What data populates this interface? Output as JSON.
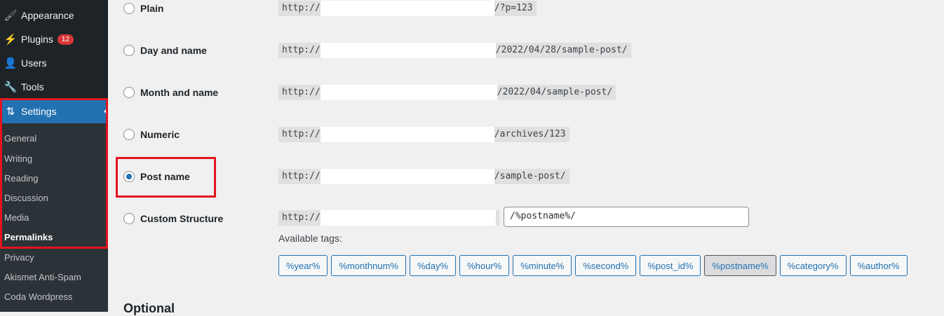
{
  "sidebar": {
    "menu": [
      {
        "label": "Appearance",
        "icon": "paintbrush-icon"
      },
      {
        "label": "Plugins",
        "icon": "plugin-icon",
        "badge": "12"
      },
      {
        "label": "Users",
        "icon": "user-icon"
      },
      {
        "label": "Tools",
        "icon": "wrench-icon"
      },
      {
        "label": "Settings",
        "icon": "settings-icon"
      }
    ],
    "submenu": [
      "General",
      "Writing",
      "Reading",
      "Discussion",
      "Media",
      "Permalinks",
      "Privacy",
      "Akismet Anti-Spam",
      "Coda Wordpress"
    ]
  },
  "permalinks": {
    "options": [
      {
        "label": "Plain",
        "prefix": "http://",
        "suffix": "/?p=123",
        "selected": false
      },
      {
        "label": "Day and name",
        "prefix": "http://",
        "suffix": "/2022/04/28/sample-post/",
        "selected": false
      },
      {
        "label": "Month and name",
        "prefix": "http://",
        "suffix": "/2022/04/sample-post/",
        "selected": false
      },
      {
        "label": "Numeric",
        "prefix": "http://",
        "suffix": "/archives/123",
        "selected": false
      },
      {
        "label": "Post name",
        "prefix": "http://",
        "suffix": "/sample-post/",
        "selected": true
      },
      {
        "label": "Custom Structure",
        "prefix": "http://",
        "suffix": "",
        "selected": false
      }
    ],
    "custom_value": "/%postname%/",
    "available_tags_label": "Available tags:",
    "tags": [
      "%year%",
      "%monthnum%",
      "%day%",
      "%hour%",
      "%minute%",
      "%second%",
      "%post_id%",
      "%postname%",
      "%category%",
      "%author%"
    ],
    "active_tag": "%postname%",
    "optional_heading": "Optional"
  },
  "colors": {
    "accent": "#2271b1",
    "highlight": "#e3141e"
  }
}
